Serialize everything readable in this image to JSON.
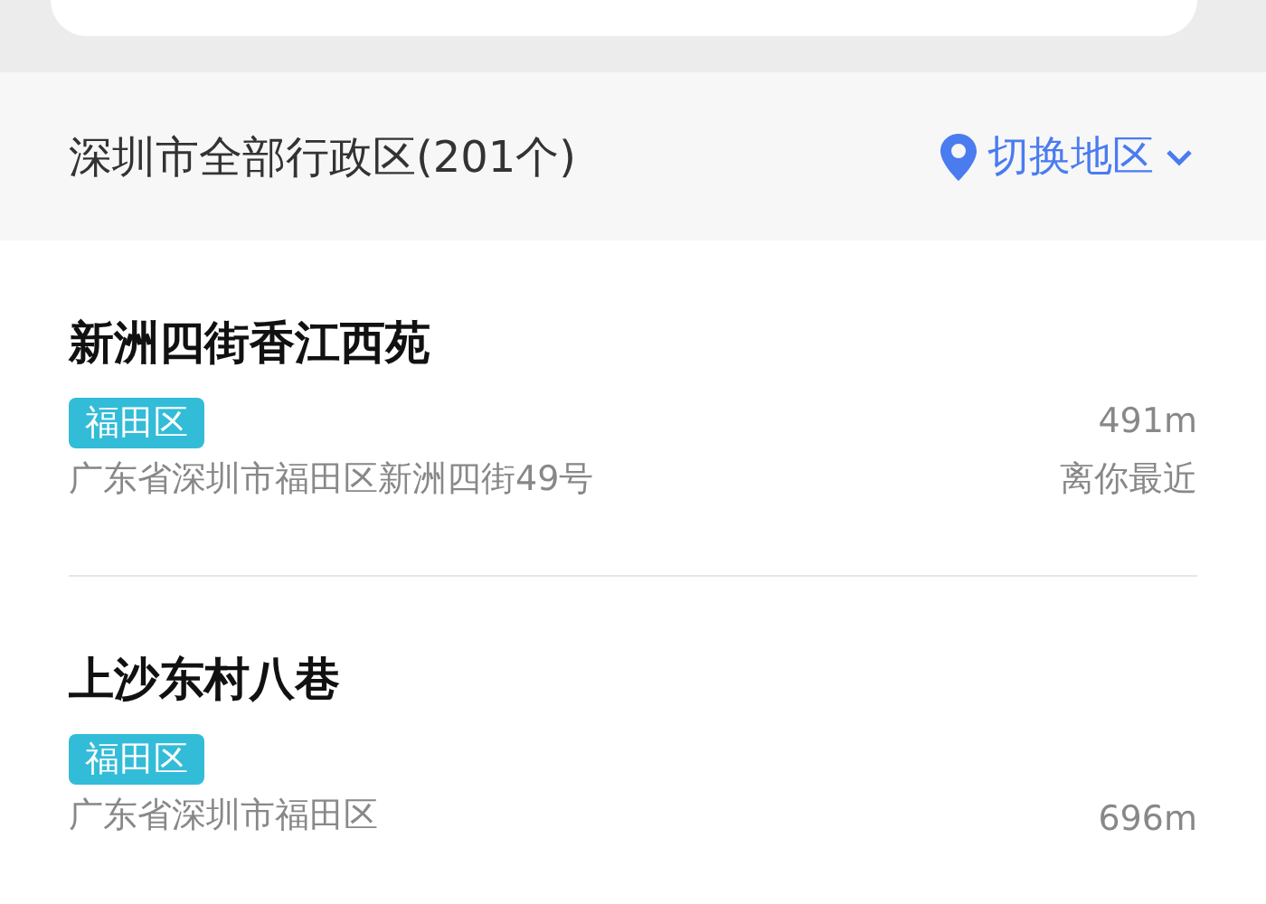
{
  "header": {
    "title": "深圳市全部行政区(201个)",
    "switch_label": "切换地区"
  },
  "places": [
    {
      "name": "新洲四街香江西苑",
      "tag": "福田区",
      "address": "广东省深圳市福田区新洲四街49号",
      "distance": "491m",
      "note": "离你最近"
    },
    {
      "name": "上沙东村八巷",
      "tag": "福田区",
      "address": "广东省深圳市福田区",
      "distance": "696m"
    }
  ]
}
